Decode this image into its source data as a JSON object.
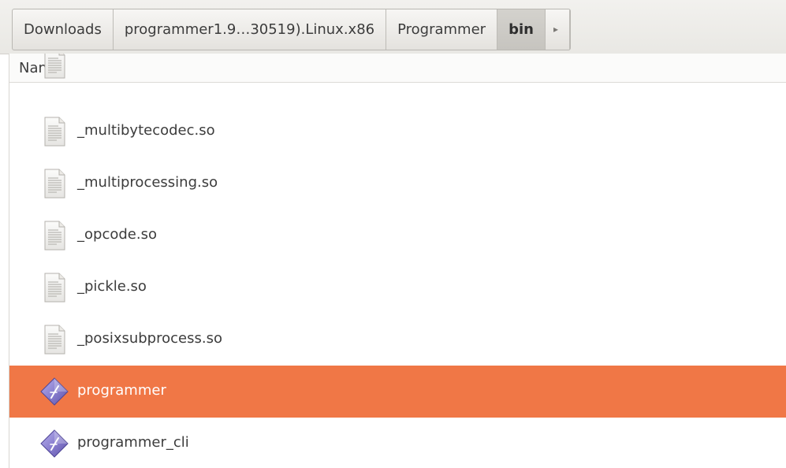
{
  "pathbar": {
    "crumbs": [
      {
        "label": "Downloads"
      },
      {
        "label": "programmer1.9…30519).Linux.x86"
      },
      {
        "label": "Programmer"
      },
      {
        "label": "bin"
      }
    ],
    "arrow_glyph": "▸"
  },
  "list": {
    "column_header": "Name",
    "files": [
      {
        "name": "_multibytecodec.so",
        "icon": "text-document-icon"
      },
      {
        "name": "_multiprocessing.so",
        "icon": "text-document-icon"
      },
      {
        "name": "_opcode.so",
        "icon": "text-document-icon"
      },
      {
        "name": "_pickle.so",
        "icon": "text-document-icon"
      },
      {
        "name": "_posixsubprocess.so",
        "icon": "text-document-icon"
      },
      {
        "name": "programmer",
        "icon": "executable-diamond-icon",
        "selected": true
      },
      {
        "name": "programmer_cli",
        "icon": "executable-diamond-icon"
      }
    ]
  },
  "colors": {
    "selection": "#f07746",
    "executable": "#8a7fd0"
  }
}
